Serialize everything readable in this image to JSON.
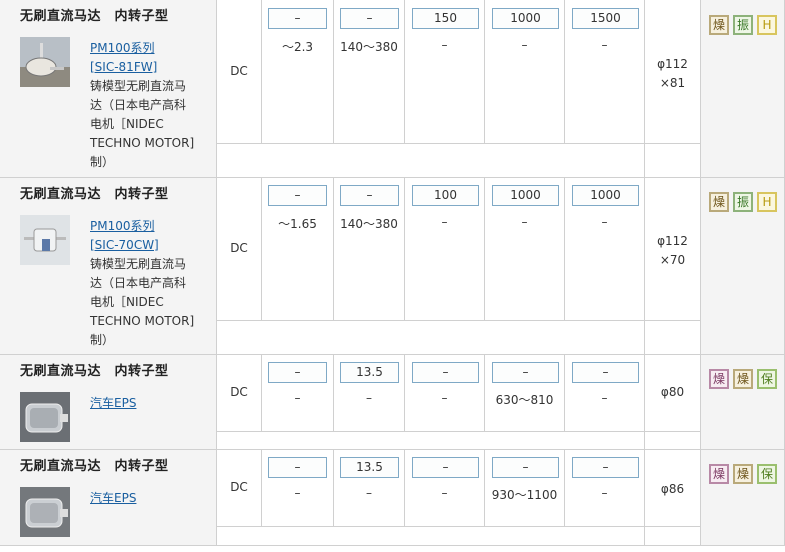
{
  "rows": [
    {
      "type": "无刷直流马达　内转子型",
      "product_link": "PM100系列[SIC-81FW]",
      "link_line1": "PM100系列",
      "link_line2": "[SIC-81FW]",
      "desc_lines": [
        "铸模型无刷直流马",
        "达（日本电产高科",
        "电机［NIDEC",
        "TECHNO MOTOR]",
        "制）"
      ],
      "power": "DC",
      "boxes": [
        "–",
        "–",
        "150",
        "1000",
        "1500"
      ],
      "subs": [
        "～2.3",
        "140～380",
        "–",
        "–",
        "–"
      ],
      "dims": [
        "φ112",
        "×81"
      ],
      "icons": [
        {
          "label": "燥",
          "icon": "dry-icon",
          "color": "#6b5217"
        },
        {
          "label": "振",
          "icon": "vibration-icon",
          "color": "#3c7a2a"
        },
        {
          "label": "H",
          "icon": "humidity-icon",
          "color": "#b89b10"
        }
      ]
    },
    {
      "type": "无刷直流马达　内转子型",
      "product_link": "PM100系列[SIC-70CW]",
      "link_line1": "PM100系列",
      "link_line2": "[SIC-70CW]",
      "desc_lines": [
        "铸模型无刷直流马",
        "达（日本电产高科",
        "电机［NIDEC",
        "TECHNO MOTOR]",
        "制）"
      ],
      "power": "DC",
      "boxes": [
        "–",
        "–",
        "100",
        "1000",
        "1000"
      ],
      "subs": [
        "～1.65",
        "140～380",
        "–",
        "–",
        "–"
      ],
      "dims": [
        "φ112",
        "×70"
      ],
      "icons": [
        {
          "label": "燥",
          "icon": "dry-icon",
          "color": "#6b5217"
        },
        {
          "label": "振",
          "icon": "vibration-icon",
          "color": "#3c7a2a"
        },
        {
          "label": "H",
          "icon": "humidity-icon",
          "color": "#b89b10"
        }
      ]
    },
    {
      "type": "无刷直流马达　内转子型",
      "product_link": "汽车EPS",
      "power": "DC",
      "boxes": [
        "–",
        "13.5",
        "–",
        "–",
        "–"
      ],
      "subs": [
        "–",
        "–",
        "–",
        "630～810",
        "–"
      ],
      "dims": [
        "φ80"
      ],
      "icons": [
        {
          "label": "燥",
          "icon": "heat-icon",
          "color": "#7a3660"
        },
        {
          "label": "燥",
          "icon": "dry-icon",
          "color": "#6b5217"
        },
        {
          "label": "保",
          "icon": "protect-icon",
          "color": "#4f7d1f"
        }
      ]
    },
    {
      "type": "无刷直流马达　内转子型",
      "product_link": "汽车EPS",
      "power": "DC",
      "boxes": [
        "–",
        "13.5",
        "–",
        "–",
        "–"
      ],
      "subs": [
        "–",
        "–",
        "–",
        "930～1100",
        "–"
      ],
      "dims": [
        "φ86"
      ],
      "icons": [
        {
          "label": "燥",
          "icon": "heat-icon",
          "color": "#7a3660"
        },
        {
          "label": "燥",
          "icon": "dry-icon",
          "color": "#6b5217"
        },
        {
          "label": "保",
          "icon": "protect-icon",
          "color": "#4f7d1f"
        }
      ]
    }
  ]
}
